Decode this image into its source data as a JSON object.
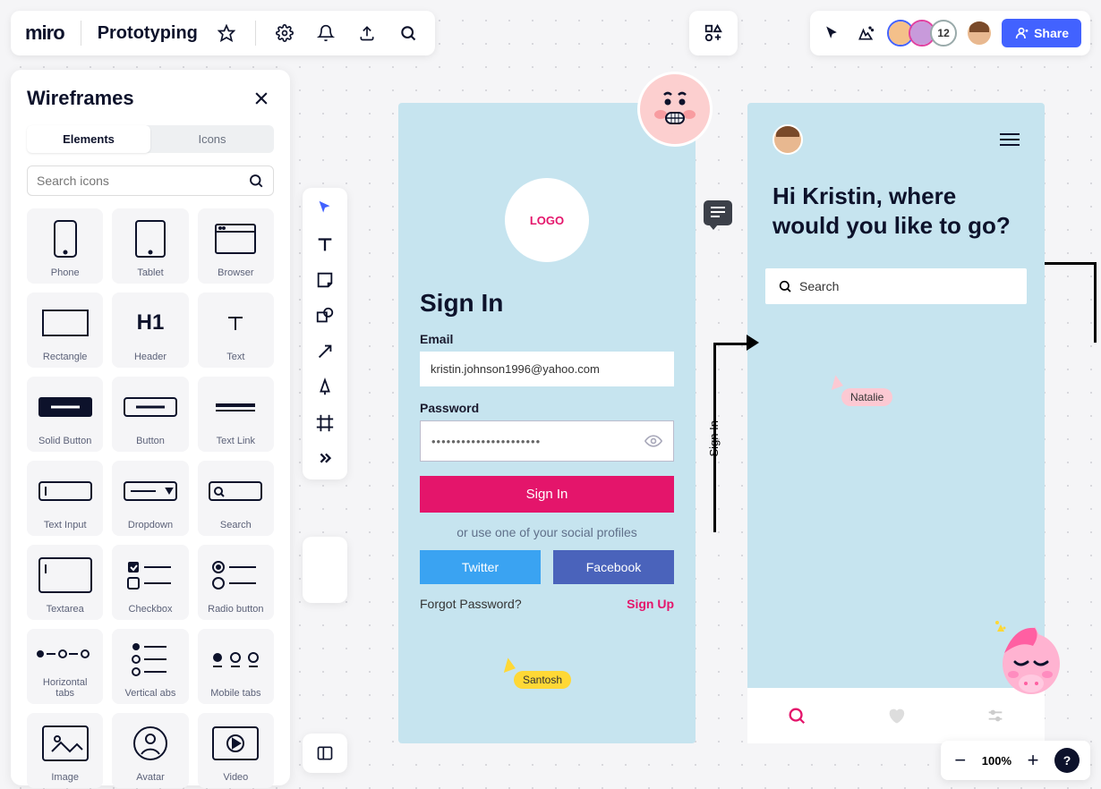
{
  "header": {
    "logo": "miro",
    "board_name": "Prototyping",
    "share_label": "Share",
    "collab_count": "12"
  },
  "panel": {
    "title": "Wireframes",
    "tab_elements": "Elements",
    "tab_icons": "Icons",
    "search_placeholder": "Search icons",
    "items": [
      "Phone",
      "Tablet",
      "Browser",
      "Rectangle",
      "Header",
      "Text",
      "Solid Button",
      "Button",
      "Text Link",
      "Text Input",
      "Dropdown",
      "Search",
      "Textarea",
      "Checkbox",
      "Radio button",
      "Horizontal tabs",
      "Vertical abs",
      "Mobile tabs",
      "Image",
      "Avatar",
      "Video"
    ]
  },
  "screen1": {
    "logo": "LOGO",
    "title": "Sign In",
    "email_label": "Email",
    "email_value": "kristin.johnson1996@yahoo.com",
    "password_label": "Password",
    "password_value": "••••••••••••••••••••••",
    "signin_btn": "Sign In",
    "or_text": "or use one of your social profiles",
    "twitter": "Twitter",
    "facebook": "Facebook",
    "forgot": "Forgot Password?",
    "signup": "Sign Up"
  },
  "screen2": {
    "greeting": "Hi Kristin, where would you like to go?",
    "search_placeholder": "Search"
  },
  "connectors": {
    "label1": "Sign In"
  },
  "cursors": {
    "natalie": "Natalie",
    "santosh": "Santosh"
  },
  "zoom": {
    "value": "100%"
  }
}
